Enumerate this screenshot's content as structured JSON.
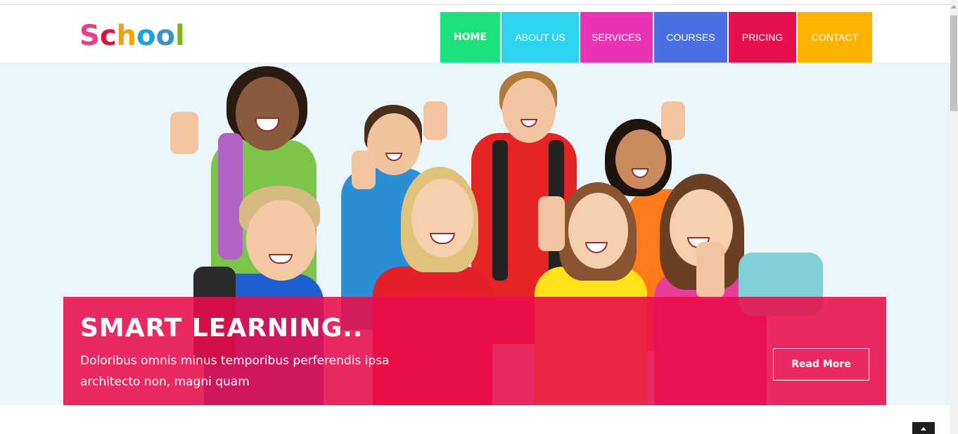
{
  "logo": {
    "letters": [
      {
        "ch": "S",
        "color": "#e83e8c"
      },
      {
        "ch": "c",
        "color": "#dc143c"
      },
      {
        "ch": "h",
        "color": "#f4a300"
      },
      {
        "ch": "o",
        "color": "#1aa3e0"
      },
      {
        "ch": "o",
        "color": "#3e8ed0"
      },
      {
        "ch": "l",
        "color": "#7cb518"
      }
    ]
  },
  "nav": {
    "items": [
      {
        "label": "HOME",
        "color": "#1ce27b",
        "active": true
      },
      {
        "label": "ABOUT US",
        "color": "#2ed3f0",
        "active": false
      },
      {
        "label": "SERVICES",
        "color": "#e935b3",
        "active": false
      },
      {
        "label": "COURSES",
        "color": "#4a6fe3",
        "active": false
      },
      {
        "label": "PRICING",
        "color": "#e80f4f",
        "active": false
      },
      {
        "label": "CONTACT",
        "color": "#ffb300",
        "active": false
      }
    ]
  },
  "hero": {
    "title": "SMART LEARNING..",
    "text": "Doloribus omnis minus temporibus perferendis ipsa architecto non, magni quam",
    "button": "Read More",
    "banner_color": "#e90d4b"
  }
}
